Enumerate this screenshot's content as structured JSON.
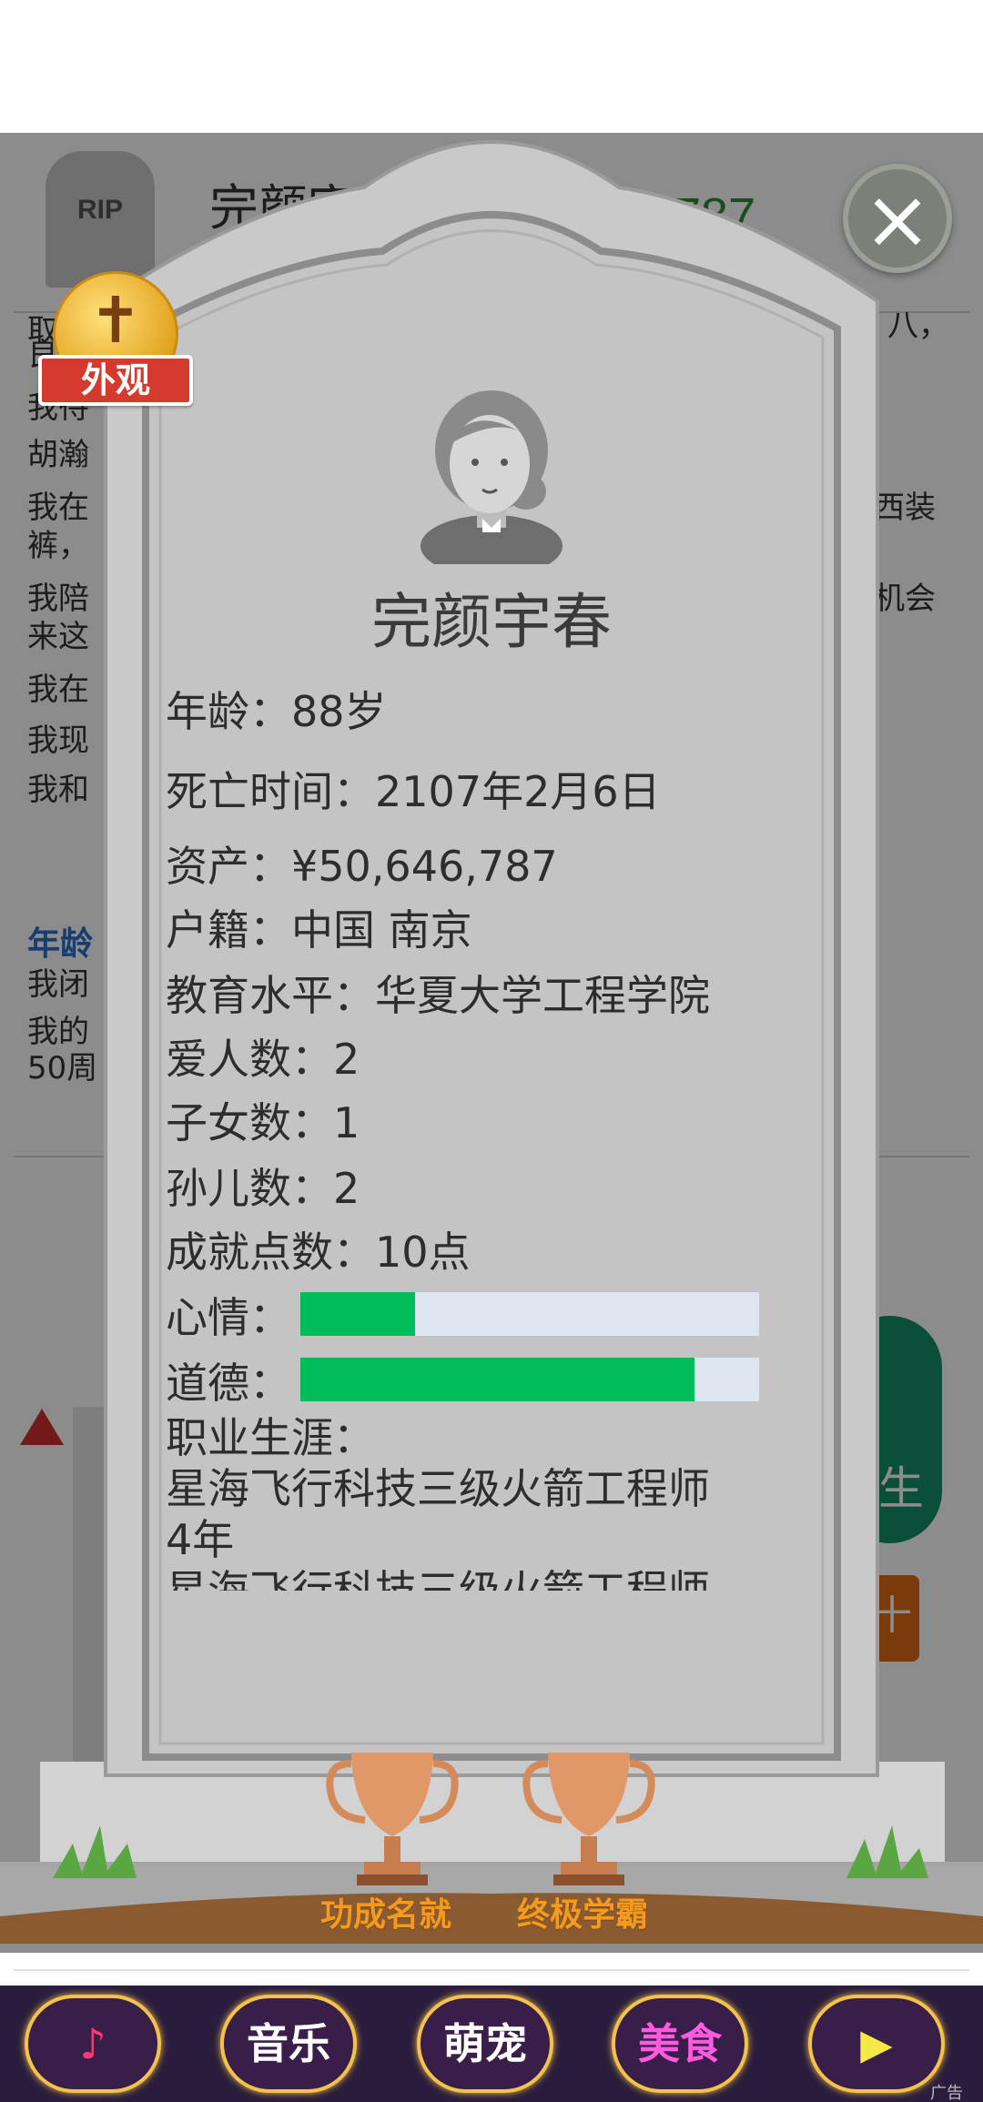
{
  "background": {
    "rip_text": "RIP",
    "name_partial": "完颜宇",
    "money_partial": "787",
    "log_lines": [
      "取",
      "良",
      "我待",
      "胡瀚",
      "我在",
      "裤，",
      "我陪",
      "来这",
      "我在",
      "我现",
      "我和"
    ],
    "log_right_fragments": [
      "八，",
      "西装",
      "机会"
    ],
    "age_section_title": "年龄",
    "age_lines": [
      "我闭",
      "我的",
      "50周"
    ],
    "green_button_text": "生",
    "orange_button_text": "十"
  },
  "modal": {
    "close_icon": "×",
    "badge": {
      "cross": "✝",
      "label": "外观"
    },
    "name": "完颜宇春",
    "info": {
      "age": "年龄：88岁",
      "death_time": "死亡时间：2107年2月6日",
      "assets": "资产：¥50,646,787",
      "hukou": "户籍：中国 南京",
      "education": "教育水平：华夏大学工程学院",
      "lovers": "爱人数：2",
      "children": "子女数：1",
      "grandchildren": "孙儿数：2",
      "achievement_points": "成就点数：10点"
    },
    "mood": {
      "label": "心情：",
      "value": 0.25
    },
    "morality": {
      "label": "道德：",
      "value": 0.86
    },
    "career": {
      "title": "职业生涯：",
      "items": [
        "星海飞行科技三级火箭工程师",
        "4年",
        "星海飞行科技三级火箭工程师"
      ]
    },
    "trophies": [
      {
        "label": "功成名就"
      },
      {
        "label": "终极学霸"
      }
    ],
    "colors": {
      "bar_fill": "#00bd5a",
      "bar_track": "#dde6f0",
      "stone": "#c5c5c5"
    }
  },
  "bottom_bar": {
    "buttons": [
      {
        "label": "♪",
        "color": "#ff3a6e",
        "icon": "tiktok-icon"
      },
      {
        "label": "音乐",
        "color": "#ffffff"
      },
      {
        "label": "萌宠",
        "color": "#ffffff"
      },
      {
        "label": "美食",
        "color": "#ff5ae0"
      },
      {
        "label": "▶",
        "color": "#f3ea4a",
        "icon": "play-icon"
      }
    ],
    "ad_label": "广告"
  }
}
